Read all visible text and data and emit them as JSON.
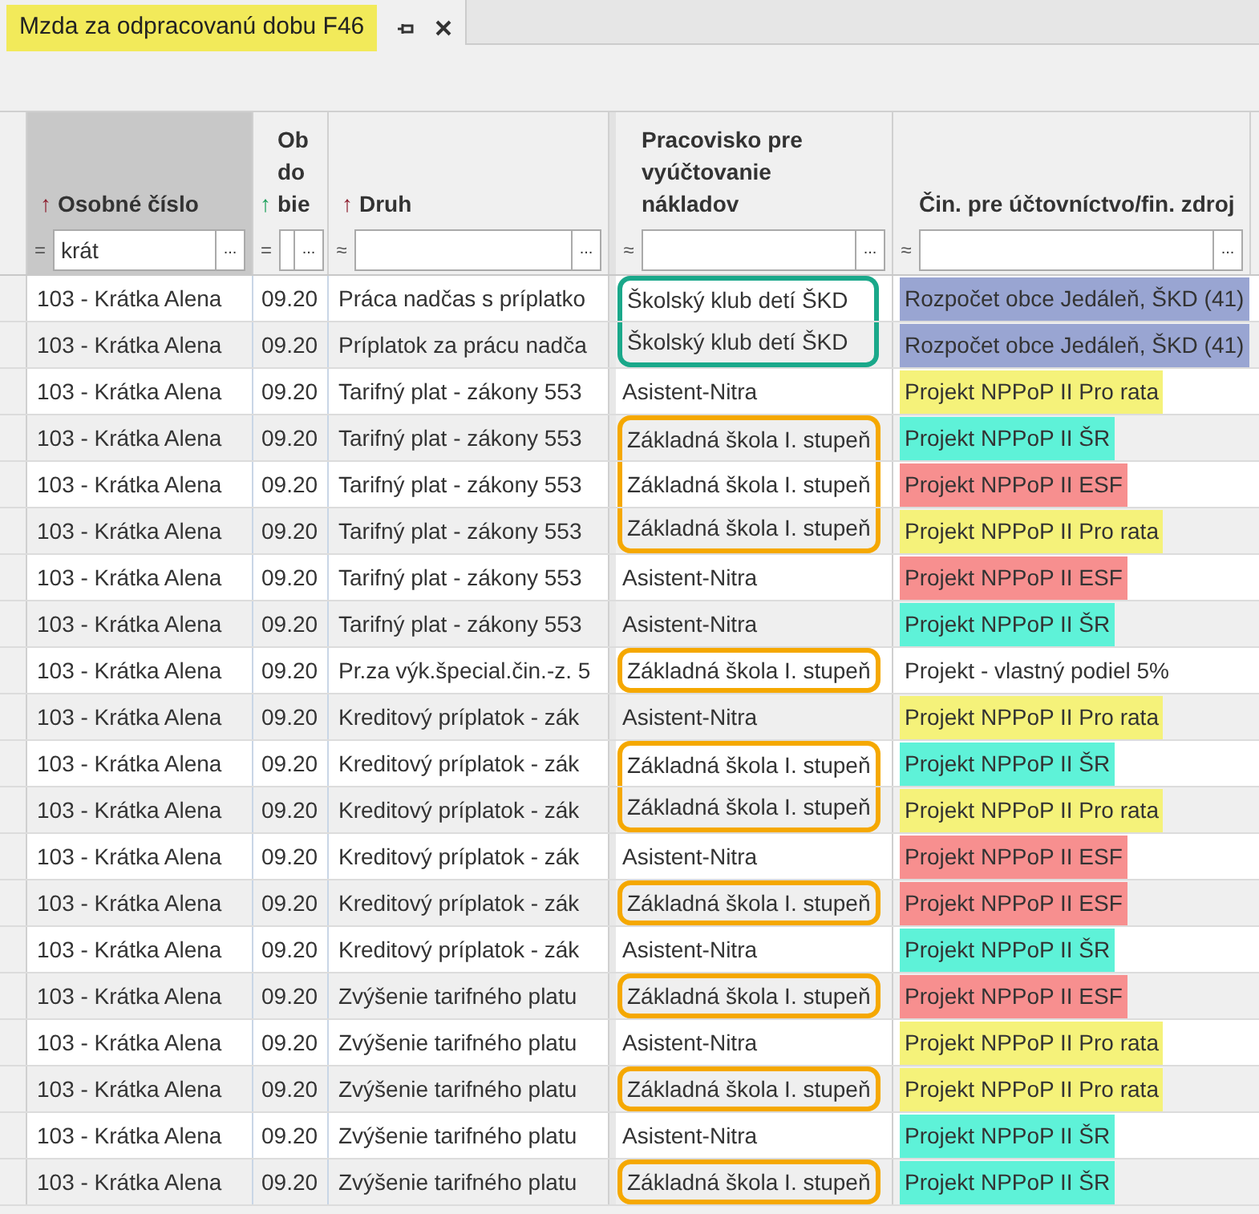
{
  "tab": {
    "title": "Mzda za odpracovanú dobu F46",
    "highlighted": true,
    "selected": true
  },
  "columns": [
    {
      "label": "Osobné číslo",
      "sort_arrow": {
        "glyph": "↑",
        "color": "#8b1a2b"
      },
      "selected": true,
      "filter_operator": "=",
      "filter_value": "krát",
      "filter_button": "..."
    },
    {
      "label": "Ob do bie",
      "sort_arrow": {
        "glyph": "↑",
        "color": "#1aa05a"
      },
      "selected": false,
      "filter_operator": "=",
      "filter_button": "..."
    },
    {
      "label": "Druh",
      "sort_arrow": {
        "glyph": "↑",
        "color": "#8b1a2b"
      },
      "selected": false,
      "filter_operator": "≈",
      "filter_button": "..."
    },
    {
      "label": "Pracovisko pre vyúčtovanie nákladov",
      "selected": false,
      "filter_operator": "≈",
      "filter_button": "..."
    },
    {
      "label": "Čin. pre účtovníctvo/fin. zdroj",
      "selected": false,
      "filter_operator": "≈",
      "filter_button": "..."
    }
  ],
  "rows": [
    {
      "employee": "103 - Krátka Alena",
      "period": "09.20",
      "type": "Práca nadčas s príplatko",
      "workplace": "Školský klub detí ŠKD",
      "outline": {
        "color": "#1aa88a"
      },
      "source": "Rozpočet obce Jedáleň, ŠKD (41)",
      "color": "#99a5d2"
    },
    {
      "employee": "103 - Krátka Alena",
      "period": "09.20",
      "type": "Príplatok za prácu nadča",
      "workplace": "Školský klub detí ŠKD",
      "outline": {
        "color": "#1aa88a"
      },
      "source": "Rozpočet obce Jedáleň, ŠKD (41)",
      "color": "#99a5d2"
    },
    {
      "employee": "103 - Krátka Alena",
      "period": "09.20",
      "type": "Tarifný plat - zákony 553",
      "workplace": "Asistent-Nitra",
      "source": "Projekt NPPoP II Pro rata",
      "color": "#f5f27a"
    },
    {
      "employee": "103 - Krátka Alena",
      "period": "09.20",
      "type": "Tarifný plat - zákony 553",
      "workplace": "Základná škola I. stupeň",
      "outline": {
        "color": "#f5a800"
      },
      "source": "Projekt NPPoP II ŠR",
      "color": "#5ef2d8"
    },
    {
      "employee": "103 - Krátka Alena",
      "period": "09.20",
      "type": "Tarifný plat - zákony 553",
      "workplace": "Základná škola I. stupeň",
      "outline": {
        "color": "#f5a800"
      },
      "source": "Projekt NPPoP II ESF",
      "color": "#f78f8f"
    },
    {
      "employee": "103 - Krátka Alena",
      "period": "09.20",
      "type": "Tarifný plat - zákony 553",
      "workplace": "Základná škola I. stupeň",
      "outline": {
        "color": "#f5a800"
      },
      "source": "Projekt NPPoP II Pro rata",
      "color": "#f5f27a"
    },
    {
      "employee": "103 - Krátka Alena",
      "period": "09.20",
      "type": "Tarifný plat - zákony 553",
      "workplace": "Asistent-Nitra",
      "source": "Projekt NPPoP II ESF",
      "color": "#f78f8f"
    },
    {
      "employee": "103 - Krátka Alena",
      "period": "09.20",
      "type": "Tarifný plat - zákony 553",
      "workplace": "Asistent-Nitra",
      "source": "Projekt NPPoP II ŠR",
      "color": "#5ef2d8"
    },
    {
      "employee": "103 - Krátka Alena",
      "period": "09.20",
      "type": "Pr.za výk.špecial.čin.-z. 5",
      "workplace": "Základná škola I. stupeň",
      "outline": {
        "color": "#f5a800"
      },
      "source": "Projekt - vlastný podiel 5%"
    },
    {
      "employee": "103 - Krátka Alena",
      "period": "09.20",
      "type": "Kreditový príplatok - zák",
      "workplace": "Asistent-Nitra",
      "source": "Projekt NPPoP II Pro rata",
      "color": "#f5f27a"
    },
    {
      "employee": "103 - Krátka Alena",
      "period": "09.20",
      "type": "Kreditový príplatok - zák",
      "workplace": "Základná škola I. stupeň",
      "outline": {
        "color": "#f5a800"
      },
      "source": "Projekt NPPoP II ŠR",
      "color": "#5ef2d8"
    },
    {
      "employee": "103 - Krátka Alena",
      "period": "09.20",
      "type": "Kreditový príplatok - zák",
      "workplace": "Základná škola I. stupeň",
      "outline": {
        "color": "#f5a800"
      },
      "source": "Projekt NPPoP II Pro rata",
      "color": "#f5f27a"
    },
    {
      "employee": "103 - Krátka Alena",
      "period": "09.20",
      "type": "Kreditový príplatok - zák",
      "workplace": "Asistent-Nitra",
      "source": "Projekt NPPoP II ESF",
      "color": "#f78f8f"
    },
    {
      "employee": "103 - Krátka Alena",
      "period": "09.20",
      "type": "Kreditový príplatok - zák",
      "workplace": "Základná škola I. stupeň",
      "outline": {
        "color": "#f5a800"
      },
      "source": "Projekt NPPoP II ESF",
      "color": "#f78f8f"
    },
    {
      "employee": "103 - Krátka Alena",
      "period": "09.20",
      "type": "Kreditový príplatok - zák",
      "workplace": "Asistent-Nitra",
      "source": "Projekt NPPoP II ŠR",
      "color": "#5ef2d8"
    },
    {
      "employee": "103 - Krátka Alena",
      "period": "09.20",
      "type": "Zvýšenie tarifného platu",
      "workplace": "Základná škola I. stupeň",
      "outline": {
        "color": "#f5a800"
      },
      "source": "Projekt NPPoP II ESF",
      "color": "#f78f8f"
    },
    {
      "employee": "103 - Krátka Alena",
      "period": "09.20",
      "type": "Zvýšenie tarifného platu",
      "workplace": "Asistent-Nitra",
      "source": "Projekt NPPoP II Pro rata",
      "color": "#f5f27a"
    },
    {
      "employee": "103 - Krátka Alena",
      "period": "09.20",
      "type": "Zvýšenie tarifného platu",
      "workplace": "Základná škola I. stupeň",
      "outline": {
        "color": "#f5a800"
      },
      "source": "Projekt NPPoP II Pro rata",
      "color": "#f5f27a"
    },
    {
      "employee": "103 - Krátka Alena",
      "period": "09.20",
      "type": "Zvýšenie tarifného platu",
      "workplace": "Asistent-Nitra",
      "source": "Projekt NPPoP II ŠR",
      "color": "#5ef2d8"
    },
    {
      "employee": "103 - Krátka Alena",
      "period": "09.20",
      "type": "Zvýšenie tarifného platu",
      "workplace": "Základná škola I. stupeň",
      "outline": {
        "color": "#f5a800"
      },
      "source": "Projekt NPPoP II ŠR",
      "color": "#5ef2d8"
    }
  ]
}
